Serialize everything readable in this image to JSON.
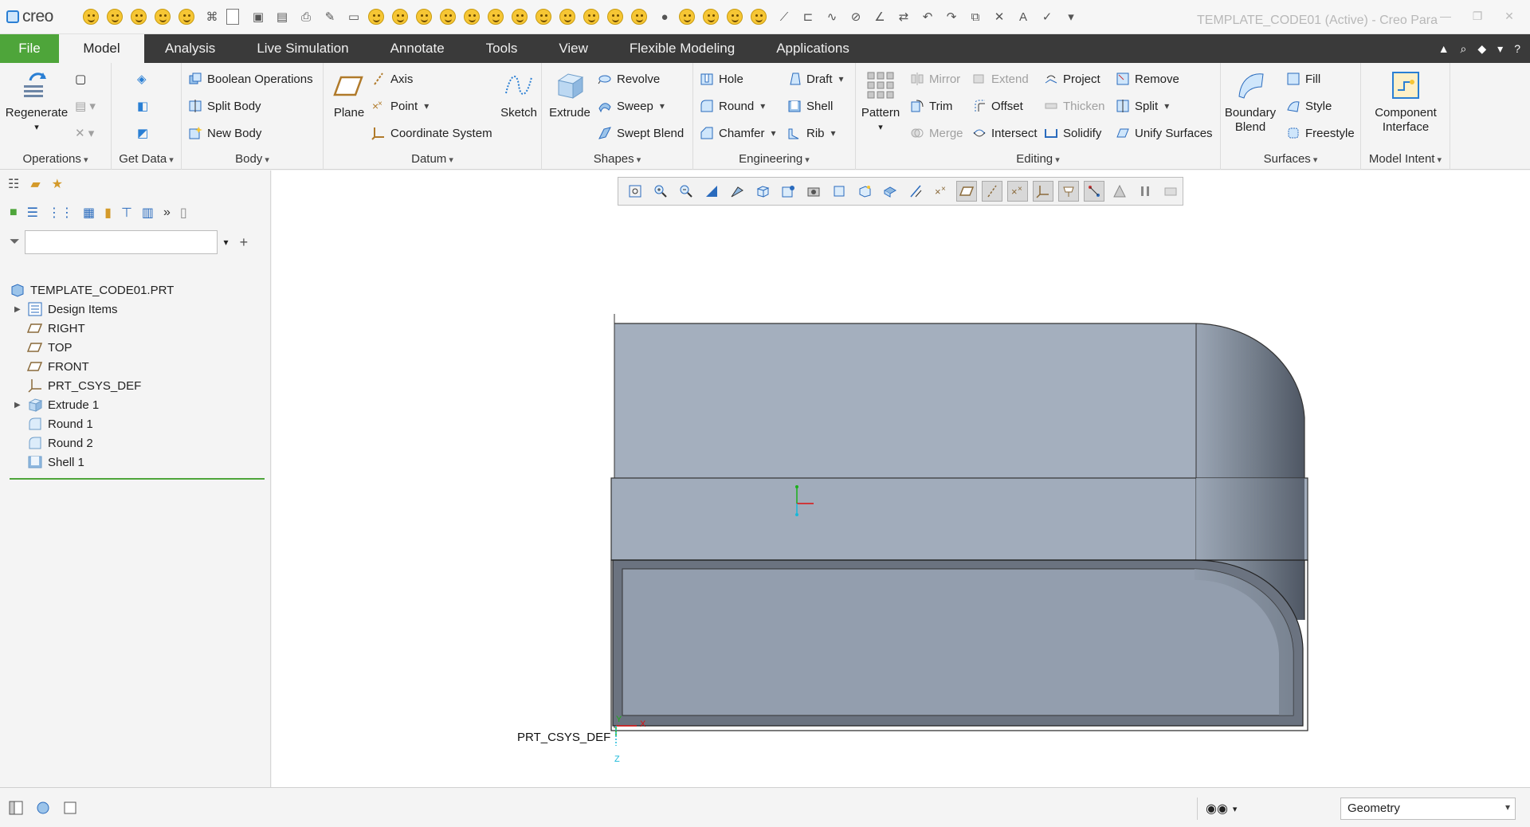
{
  "app": {
    "logo": "creo",
    "window_title": "TEMPLATE_CODE01 (Active) - Creo Para"
  },
  "tabs": [
    {
      "label": "File"
    },
    {
      "label": "Model"
    },
    {
      "label": "Analysis"
    },
    {
      "label": "Live Simulation"
    },
    {
      "label": "Annotate"
    },
    {
      "label": "Tools"
    },
    {
      "label": "View"
    },
    {
      "label": "Flexible Modeling"
    },
    {
      "label": "Applications"
    }
  ],
  "ribbon": {
    "operations": {
      "label": "Operations",
      "regenerate": "Regenerate"
    },
    "get_data": {
      "label": "Get Data"
    },
    "body": {
      "label": "Body",
      "boolean": "Boolean Operations",
      "split_body": "Split Body",
      "new_body": "New Body"
    },
    "datum": {
      "label": "Datum",
      "plane": "Plane",
      "axis": "Axis",
      "point": "Point",
      "csys": "Coordinate System",
      "sketch": "Sketch"
    },
    "shapes": {
      "label": "Shapes",
      "extrude": "Extrude",
      "revolve": "Revolve",
      "sweep": "Sweep",
      "swept_blend": "Swept Blend"
    },
    "engineering": {
      "label": "Engineering",
      "hole": "Hole",
      "round": "Round",
      "chamfer": "Chamfer",
      "draft": "Draft",
      "shell": "Shell",
      "rib": "Rib"
    },
    "editing": {
      "label": "Editing",
      "pattern": "Pattern",
      "mirror": "Mirror",
      "trim": "Trim",
      "merge": "Merge",
      "extend": "Extend",
      "offset": "Offset",
      "intersect": "Intersect",
      "project": "Project",
      "thicken": "Thicken",
      "solidify": "Solidify",
      "remove": "Remove",
      "split": "Split",
      "unify": "Unify Surfaces"
    },
    "surfaces": {
      "label": "Surfaces",
      "boundary_blend_1": "Boundary",
      "boundary_blend_2": "Blend",
      "fill": "Fill",
      "style": "Style",
      "freestyle": "Freestyle"
    },
    "model_intent": {
      "label": "Model Intent",
      "component_1": "Component",
      "component_2": "Interface"
    }
  },
  "filter": {
    "value": "",
    "placeholder": ""
  },
  "tree": [
    {
      "label": "TEMPLATE_CODE01.PRT",
      "expandable": false
    },
    {
      "label": "Design Items",
      "expandable": true
    },
    {
      "label": "RIGHT",
      "expandable": false
    },
    {
      "label": "TOP",
      "expandable": false
    },
    {
      "label": "FRONT",
      "expandable": false
    },
    {
      "label": "PRT_CSYS_DEF",
      "expandable": false
    },
    {
      "label": "Extrude 1",
      "expandable": true
    },
    {
      "label": "Round 1",
      "expandable": false
    },
    {
      "label": "Round 2",
      "expandable": false
    },
    {
      "label": "Shell 1",
      "expandable": false
    }
  ],
  "viewport": {
    "csys_label": "PRT_CSYS_DEF",
    "axis_x": "X",
    "axis_y": "Y",
    "axis_z": "Z"
  },
  "status": {
    "filter_value": "Geometry"
  },
  "colors": {
    "accent_green": "#4ea53a",
    "tab_dark": "#3a3a3a",
    "model_fill": "#9aa6b6",
    "model_dark": "#4e5663"
  }
}
